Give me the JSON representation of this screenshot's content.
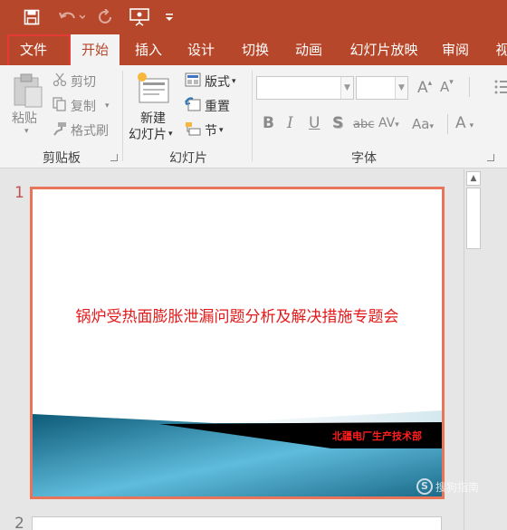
{
  "quick_access": {
    "icons": [
      "save-icon",
      "undo-icon",
      "redo-icon",
      "present-from-start-icon",
      "customize-qat-icon"
    ]
  },
  "tabs": [
    {
      "label": "文件",
      "active": false
    },
    {
      "label": "开始",
      "active": true
    },
    {
      "label": "插入",
      "active": false
    },
    {
      "label": "设计",
      "active": false
    },
    {
      "label": "切换",
      "active": false
    },
    {
      "label": "动画",
      "active": false
    },
    {
      "label": "幻灯片放映",
      "active": false
    },
    {
      "label": "审阅",
      "active": false
    },
    {
      "label": "视",
      "active": false
    }
  ],
  "ribbon": {
    "clipboard": {
      "paste_label": "粘贴",
      "cut_label": "剪切",
      "copy_label": "复制",
      "format_painter_label": "格式刷",
      "group_label": "剪贴板"
    },
    "slides": {
      "new_slide_line1": "新建",
      "new_slide_line2": "幻灯片",
      "layout_label": "版式",
      "reset_label": "重置",
      "section_label": "节",
      "group_label": "幻灯片"
    },
    "font": {
      "font_name_value": "",
      "font_size_value": "",
      "grow_label": "A",
      "shrink_label": "A",
      "bold_label": "B",
      "italic_label": "I",
      "underline_label": "U",
      "shadow_label": "S",
      "strike_label": "abc",
      "spacing_label": "AV",
      "case_label": "Aa",
      "color_label": "A",
      "group_label": "字体"
    }
  },
  "slides": [
    {
      "number": "1",
      "title": "锅炉受热面膨胀泄漏问题分析及解决措施专题会",
      "footer": "北疆电厂生产技术部"
    },
    {
      "number": "2"
    }
  ],
  "watermark": {
    "logo": "S",
    "text": "搜狗指南"
  },
  "colors": {
    "accent": "#b7472a",
    "title_red": "#e21a1a",
    "slide_border": "#e8745a",
    "highlight_box": "#e53935"
  }
}
